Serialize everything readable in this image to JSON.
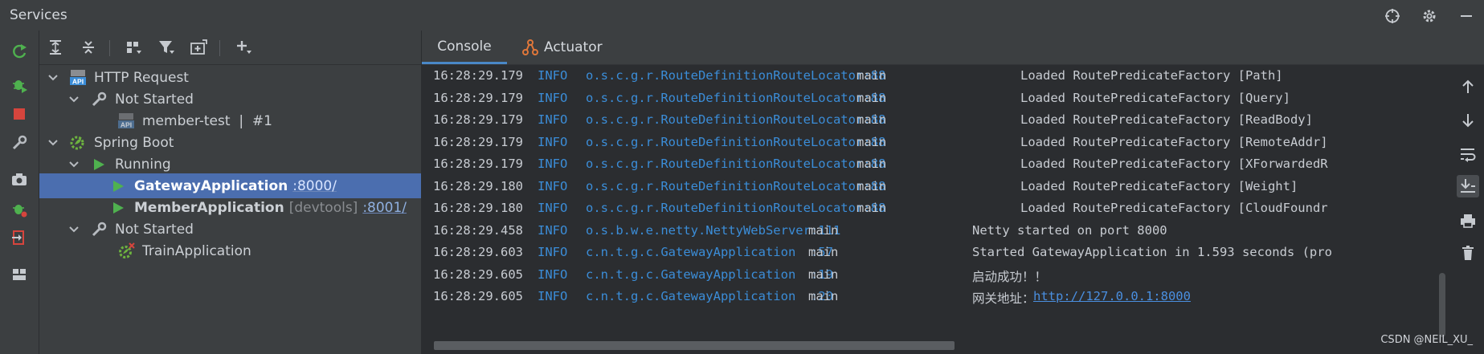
{
  "window": {
    "title": "Services",
    "toolbar_icons": [
      "crosshair-icon",
      "gear-icon",
      "minimize-icon"
    ]
  },
  "left_toolbar": {
    "icons": [
      "rerun-icon",
      "debug-icon",
      "stop-icon",
      "wrench-icon",
      "camera-icon",
      "attach-debugger-icon",
      "exit-icon",
      "layout-icon"
    ]
  },
  "tree_toolbar": {
    "icons": [
      "expand-all-icon",
      "collapse-all-icon",
      "group-icon",
      "filter-icon",
      "new-service-icon",
      "add-icon"
    ]
  },
  "tree": {
    "http_request": {
      "label": "HTTP Request"
    },
    "not_started_1": {
      "label": "Not Started"
    },
    "member_test": {
      "label": "member-test  |  #1"
    },
    "spring_boot": {
      "label": "Spring Boot"
    },
    "running": {
      "label": "Running"
    },
    "gateway": {
      "label": "GatewayApplication",
      "port": ":8000/"
    },
    "member": {
      "label": "MemberApplication",
      "extra": "[devtools]",
      "port": ":8001/"
    },
    "not_started_2": {
      "label": "Not Started"
    },
    "train": {
      "label": "TrainApplication"
    }
  },
  "tabs": {
    "console": "Console",
    "actuator": "Actuator"
  },
  "log": [
    {
      "time": "16:28:29.179",
      "level": "INFO",
      "logger": "o.s.c.g.r.RouteDefinitionRouteLocator:88",
      "thread": "main",
      "message": "Loaded RoutePredicateFactory [Path]"
    },
    {
      "time": "16:28:29.179",
      "level": "INFO",
      "logger": "o.s.c.g.r.RouteDefinitionRouteLocator:88",
      "thread": "main",
      "message": "Loaded RoutePredicateFactory [Query]"
    },
    {
      "time": "16:28:29.179",
      "level": "INFO",
      "logger": "o.s.c.g.r.RouteDefinitionRouteLocator:88",
      "thread": "main",
      "message": "Loaded RoutePredicateFactory [ReadBody]"
    },
    {
      "time": "16:28:29.179",
      "level": "INFO",
      "logger": "o.s.c.g.r.RouteDefinitionRouteLocator:88",
      "thread": "main",
      "message": "Loaded RoutePredicateFactory [RemoteAddr]"
    },
    {
      "time": "16:28:29.179",
      "level": "INFO",
      "logger": "o.s.c.g.r.RouteDefinitionRouteLocator:88",
      "thread": "main",
      "message": "Loaded RoutePredicateFactory [XForwardedR"
    },
    {
      "time": "16:28:29.180",
      "level": "INFO",
      "logger": "o.s.c.g.r.RouteDefinitionRouteLocator:88",
      "thread": "main",
      "message": "Loaded RoutePredicateFactory [Weight]"
    },
    {
      "time": "16:28:29.180",
      "level": "INFO",
      "logger": "o.s.c.g.r.RouteDefinitionRouteLocator:88",
      "thread": "main",
      "message": "Loaded RoutePredicateFactory [CloudFoundr"
    },
    {
      "time": "16:28:29.458",
      "level": "INFO",
      "logger": "o.s.b.w.e.netty.NettyWebServer:111",
      "thread": "main",
      "message": "Netty started on port 8000"
    },
    {
      "time": "16:28:29.603",
      "level": "INFO",
      "logger": "c.n.t.g.c.GatewayApplication  :57",
      "thread": "main",
      "message": "Started GatewayApplication in 1.593 seconds (pro"
    },
    {
      "time": "16:28:29.605",
      "level": "INFO",
      "logger": "c.n.t.g.c.GatewayApplication  :19",
      "thread": "main",
      "message": "启动成功！！"
    },
    {
      "time": "16:28:29.605",
      "level": "INFO",
      "logger": "c.n.t.g.c.GatewayApplication  :20",
      "thread": "main",
      "message": "网关地址：",
      "link": "http://127.0.0.1:8000"
    }
  ],
  "right_toolbar": {
    "icons": [
      "scroll-up-icon",
      "scroll-down-icon",
      "soft-wrap-icon",
      "scroll-to-end-icon",
      "print-icon",
      "trash-icon"
    ]
  },
  "watermark": "CSDN @NEIL_XU_",
  "colors": {
    "selection": "#4b6eaf",
    "info": "#3b8dd8",
    "running_green": "#4fb14f",
    "stop_red": "#d6453d"
  }
}
